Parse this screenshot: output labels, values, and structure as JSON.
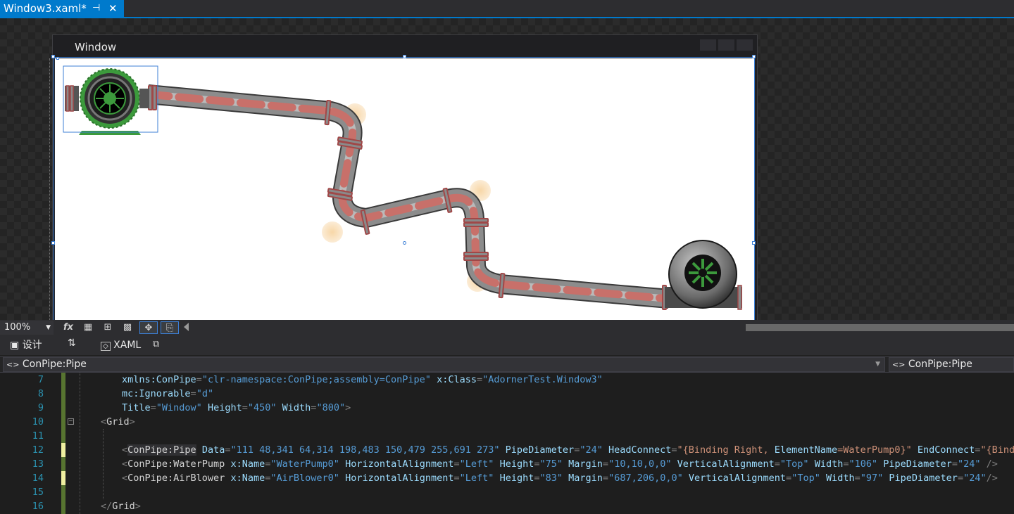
{
  "document_tab": {
    "title": "Window3.xaml*",
    "pin_icon": "pin-icon",
    "close_glyph": "✕"
  },
  "designer": {
    "window_title": "Window",
    "zoom": "100%",
    "toolbar_icons": [
      "fx-icon",
      "grid-icon",
      "snap-grid-icon",
      "artboard-background-icon",
      "snap-to-lines-icon",
      "project-code-icon"
    ],
    "fx_label": "fx"
  },
  "split_tabs": {
    "design": "设计",
    "xaml": "XAML"
  },
  "nav": {
    "left_scope": "ConPipe:Pipe",
    "right_scope": "ConPipe:Pipe"
  },
  "editor": {
    "line_numbers": [
      "7",
      "8",
      "9",
      "10",
      "11",
      "12",
      "13",
      "14",
      "15",
      "16"
    ],
    "lines": {
      "l7": {
        "a1": "xmlns:ConPipe",
        "v1": "\"clr-namespace:ConPipe;assembly=ConPipe\"",
        "a2": "x:Class",
        "v2": "\"AdornerTest.Window3\""
      },
      "l8": {
        "a1": "mc:Ignorable",
        "v1": "\"d\""
      },
      "l9": {
        "a1": "Title",
        "v1": "\"Window\"",
        "a2": "Height",
        "v2": "\"450\"",
        "a3": "Width",
        "v3": "\"800\""
      },
      "l10": {
        "tag": "Grid"
      },
      "l12": {
        "tag": "ConPipe:Pipe",
        "a1": "Data",
        "v1": "\"111 48,341 64,314 198,483 150,479 255,691 273\"",
        "a2": "PipeDiameter",
        "v2": "\"24\"",
        "a3": "HeadConnect",
        "v3a": "\"{Binding Right, ",
        "v3b": "ElementName",
        "v3c": "=WaterPump0}\"",
        "a4": "EndConnect",
        "v4": "\"{Binding"
      },
      "l13": {
        "tag": "ConPipe:WaterPump",
        "a1": "x:Name",
        "v1": "\"WaterPump0\"",
        "a2": "HorizontalAlignment",
        "v2": "\"Left\"",
        "a3": "Height",
        "v3": "\"75\"",
        "a4": "Margin",
        "v4": "\"10,10,0,0\"",
        "a5": "VerticalAlignment",
        "v5": "\"Top\"",
        "a6": "Width",
        "v6": "\"106\"",
        "a7": "PipeDiameter",
        "v7": "\"24\"",
        "end": " />"
      },
      "l14": {
        "tag": "ConPipe:AirBlower",
        "a1": "x:Name",
        "v1": "\"AirBlower0\"",
        "a2": "HorizontalAlignment",
        "v2": "\"Left\"",
        "a3": "Height",
        "v3": "\"83\"",
        "a4": "Margin",
        "v4": "\"687,206,0,0\"",
        "a5": "VerticalAlignment",
        "v5": "\"Top\"",
        "a6": "Width",
        "v6": "\"97\"",
        "a7": "PipeDiameter",
        "v7": "\"24\"",
        "end": "/>"
      },
      "l16": {
        "tag": "Grid"
      }
    }
  },
  "colors": {
    "accent": "#007acc",
    "pump_green": "#3c9a3c",
    "pipe_flow": "#c8706a",
    "selection": "#3c7fd6"
  }
}
